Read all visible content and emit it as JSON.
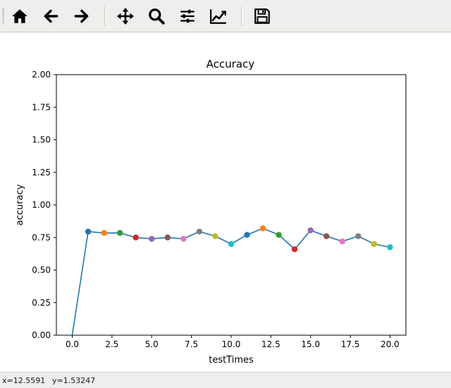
{
  "toolbar": {
    "buttons": [
      {
        "id": "home",
        "icon": "home-icon"
      },
      {
        "id": "back",
        "icon": "arrow-left-icon"
      },
      {
        "id": "forward",
        "icon": "arrow-right-icon"
      },
      {
        "id": "pan",
        "icon": "move-icon"
      },
      {
        "id": "zoom",
        "icon": "search-icon"
      },
      {
        "id": "configure",
        "icon": "sliders-icon"
      },
      {
        "id": "edit",
        "icon": "line-chart-icon"
      },
      {
        "id": "save",
        "icon": "save-icon"
      }
    ]
  },
  "status": {
    "x_text": "x=12.5591",
    "y_text": "y=1.53247"
  },
  "chart_data": {
    "type": "line",
    "title": "Accuracy",
    "xlabel": "testTimes",
    "ylabel": "accuracy",
    "xlim": [
      -1,
      21
    ],
    "ylim": [
      0,
      2
    ],
    "xticks": [
      0,
      2.5,
      5,
      7.5,
      10,
      12.5,
      15,
      17.5,
      20
    ],
    "xtick_labels": [
      "0.0",
      "2.5",
      "5.0",
      "7.5",
      "10.0",
      "12.5",
      "15.0",
      "17.5",
      "20.0"
    ],
    "yticks": [
      0,
      0.25,
      0.5,
      0.75,
      1.0,
      1.25,
      1.5,
      1.75,
      2.0
    ],
    "ytick_labels": [
      "0.00",
      "0.25",
      "0.50",
      "0.75",
      "1.00",
      "1.25",
      "1.50",
      "1.75",
      "2.00"
    ],
    "line_color": "#1f77b4",
    "x": [
      0,
      1,
      2,
      3,
      4,
      5,
      6,
      7,
      8,
      9,
      10,
      11,
      12,
      13,
      14,
      15,
      16,
      17,
      18,
      19,
      20
    ],
    "y": [
      0.0,
      0.795,
      0.785,
      0.785,
      0.75,
      0.74,
      0.75,
      0.74,
      0.795,
      0.76,
      0.7,
      0.77,
      0.82,
      0.77,
      0.66,
      0.805,
      0.76,
      0.72,
      0.76,
      0.7,
      0.675
    ],
    "marker_colors": [
      "#1f77b4",
      "#ff7f0e",
      "#2ca02c",
      "#d62728",
      "#9467bd",
      "#8c564b",
      "#e377c2",
      "#7f7f7f",
      "#bcbd22",
      "#17becf"
    ]
  }
}
